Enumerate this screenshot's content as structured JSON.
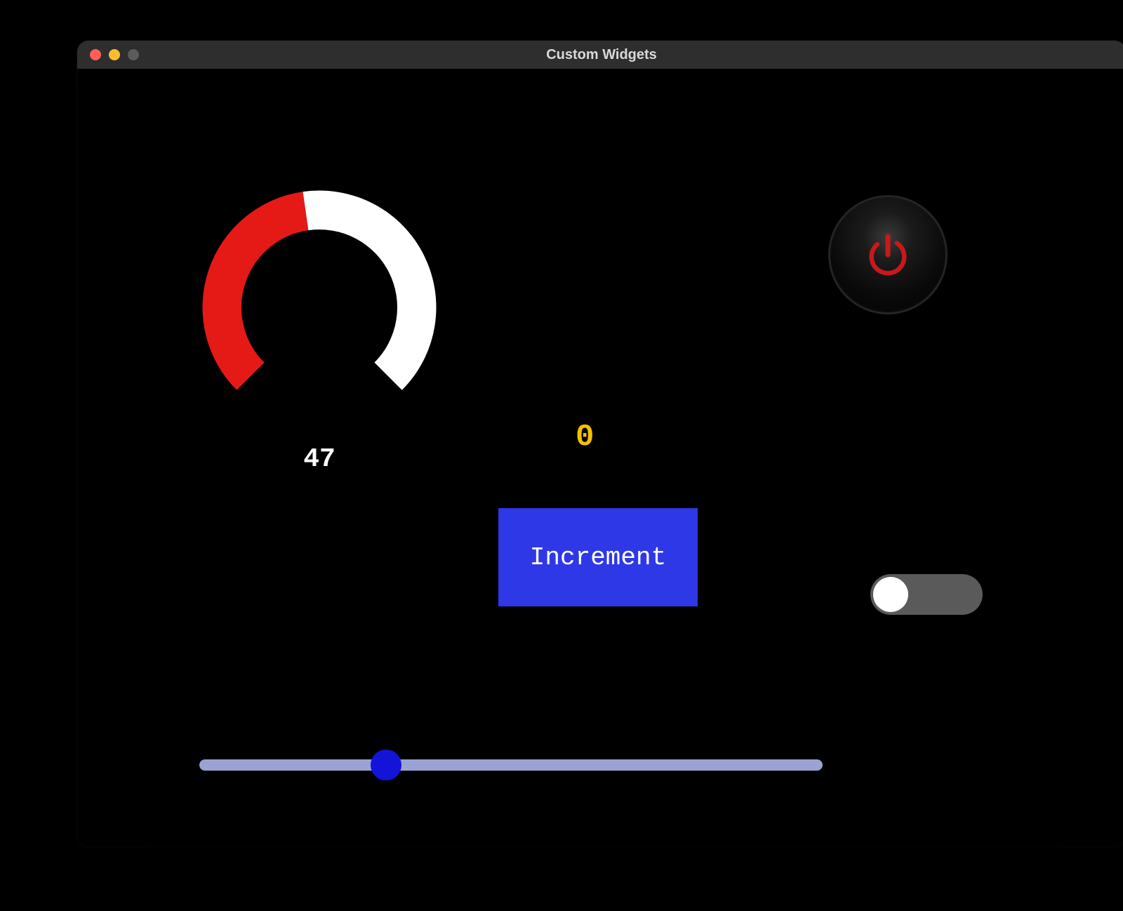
{
  "window": {
    "title": "Custom Widgets"
  },
  "gauge": {
    "value": 47,
    "max": 100,
    "start_angle_deg": 225,
    "end_angle_deg": -45,
    "filled_color": "#e51a16",
    "empty_color": "#ffffff"
  },
  "counter": {
    "value": 0
  },
  "increment_button": {
    "label": "Increment"
  },
  "power_button": {
    "icon": "power-icon",
    "glyph_color": "#d11a1a",
    "state": "off"
  },
  "toggle": {
    "state": "off"
  },
  "slider": {
    "min": 0,
    "max": 100,
    "value": 30,
    "track_color": "#9aa3d3",
    "thumb_color": "#1414d9"
  }
}
